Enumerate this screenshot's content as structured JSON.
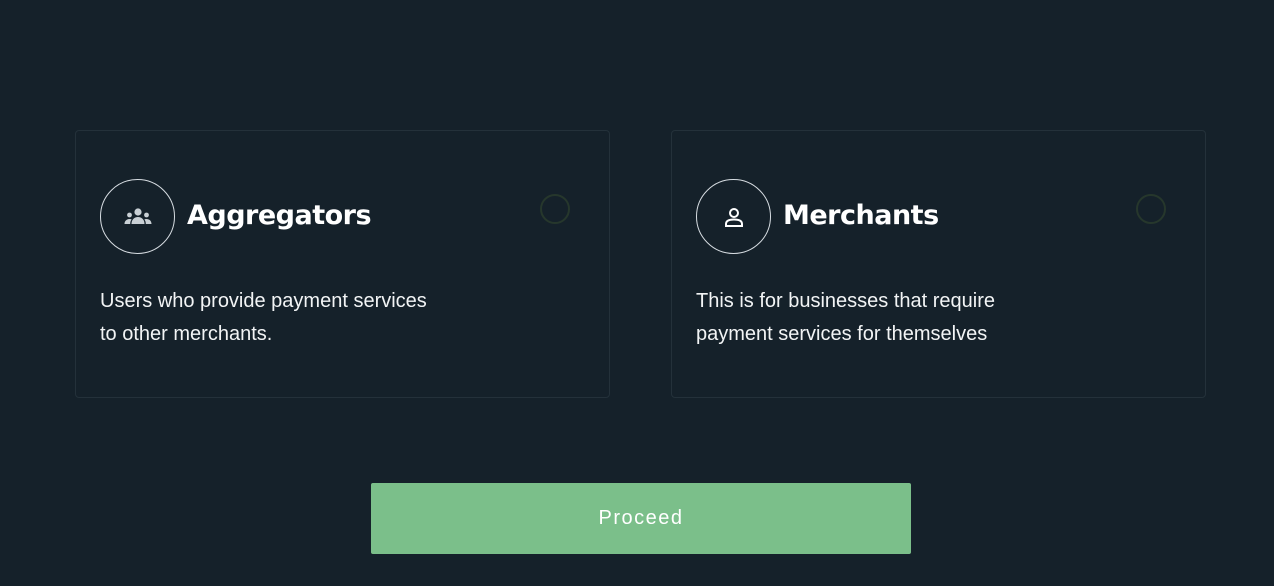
{
  "options": [
    {
      "title": "Aggregators",
      "description": "Users who provide payment services to other merchants.",
      "icon": "people-group-icon",
      "selected": false
    },
    {
      "title": "Merchants",
      "description": "This is for businesses that require payment services for themselves",
      "icon": "person-icon",
      "selected": false
    }
  ],
  "proceed_label": "Proceed",
  "colors": {
    "background": "#15212a",
    "card_border": "#24313a",
    "radio_border": "#26372c",
    "button": "#7bbf8a",
    "text": "#ffffff"
  }
}
